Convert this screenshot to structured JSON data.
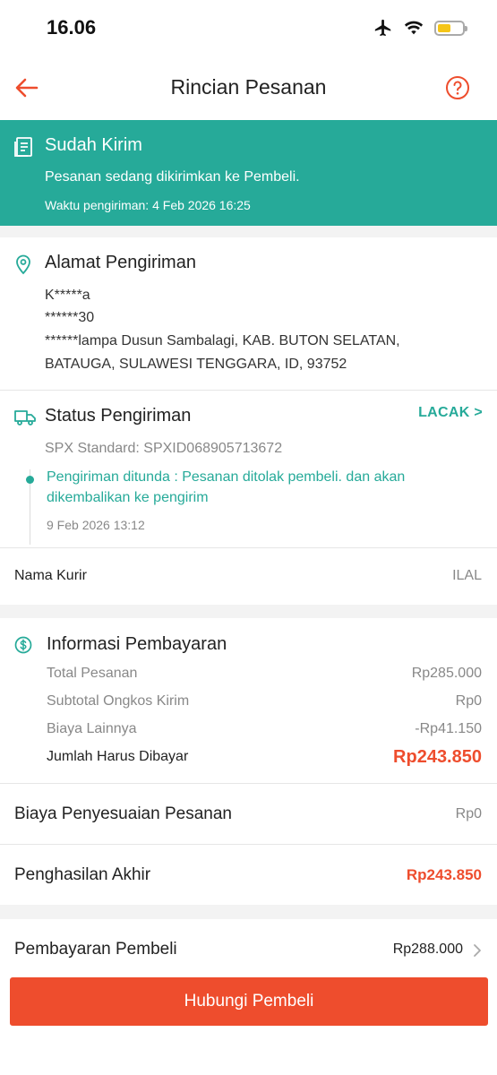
{
  "status_bar": {
    "time": "16.06"
  },
  "nav": {
    "title": "Rincian Pesanan"
  },
  "banner": {
    "title": "Sudah Kirim",
    "description": "Pesanan sedang dikirimkan ke Pembeli.",
    "time": "Waktu pengiriman: 4 Feb 2026 16:25"
  },
  "address": {
    "title": "Alamat Pengiriman",
    "name": "K*****a",
    "phone": "******30",
    "line1": "******lampa Dusun Sambalagi, KAB. BUTON SELATAN,",
    "line2": "BATAUGA, SULAWESI TENGGARA, ID, 93752"
  },
  "shipping": {
    "title": "Status Pengiriman",
    "track_label": "LACAK >",
    "service": "SPX Standard: SPXID068905713672",
    "event_line1": "Pengiriman ditunda : Pesanan ditolak pembeli. dan akan",
    "event_line2": "dikembalikan ke pengirim",
    "event_time": "9 Feb 2026 13:12",
    "courier_label": "Nama Kurir",
    "courier_value": "ILAL"
  },
  "payment": {
    "title": "Informasi Pembayaran",
    "rows": [
      {
        "label": "Total Pesanan",
        "value": "Rp285.000"
      },
      {
        "label": "Subtotal Ongkos Kirim",
        "value": "Rp0"
      },
      {
        "label": "Biaya Lainnya",
        "value": "-Rp41.150"
      }
    ],
    "total_label": "Jumlah Harus Dibayar",
    "total_value": "Rp243.850"
  },
  "adjustment": {
    "label": "Biaya Penyesuaian Pesanan",
    "value": "Rp0"
  },
  "earnings": {
    "label": "Penghasilan Akhir",
    "value": "Rp243.850"
  },
  "buyer_payment": {
    "label": "Pembayaran Pembeli",
    "value": "Rp288.000"
  },
  "cta": {
    "label": "Hubungi Pembeli"
  },
  "colors": {
    "primary": "#ee4d2d",
    "teal": "#26aa99"
  },
  "icons": [
    "back-arrow-icon",
    "help-icon",
    "receipt-icon",
    "location-pin-icon",
    "truck-icon",
    "dollar-icon",
    "chevron-right-icon",
    "airplane-icon",
    "wifi-icon",
    "battery-icon"
  ]
}
